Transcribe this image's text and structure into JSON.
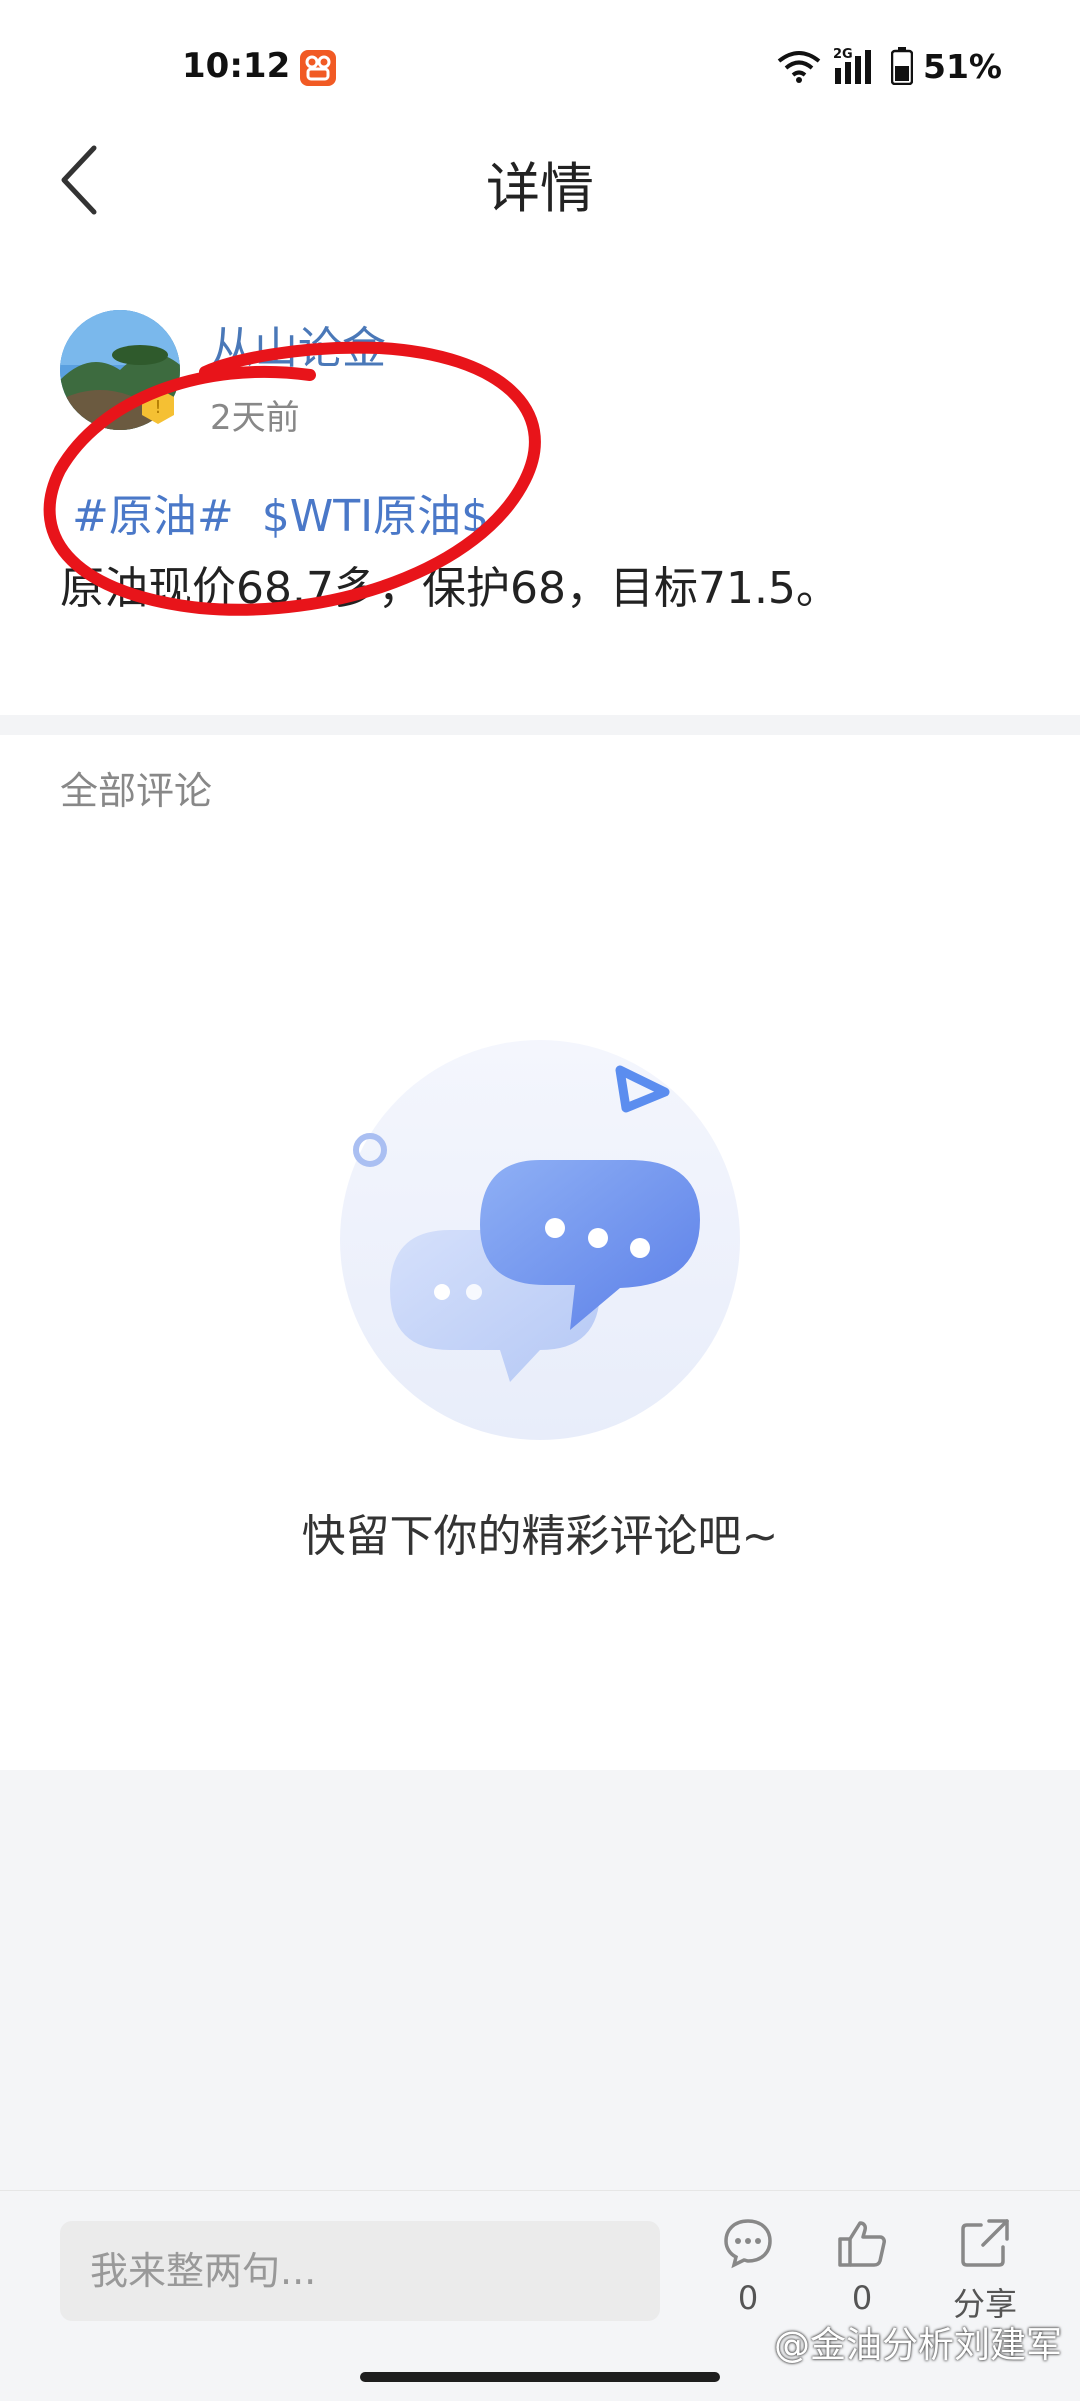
{
  "status_bar": {
    "time": "10:12",
    "network": "2G",
    "battery": "51%"
  },
  "nav": {
    "title": "详情"
  },
  "post": {
    "author": "从山论金",
    "time": "2天前",
    "tags": [
      "#原油#",
      "$WTI原油$"
    ],
    "text": "原油现价68.7多，保护68，目标71.5。"
  },
  "comments": {
    "header": "全部评论",
    "empty_text": "快留下你的精彩评论吧~"
  },
  "bottom_bar": {
    "input_placeholder": "我来整两句...",
    "comment_count": "0",
    "like_count": "0",
    "share_label": "分享"
  },
  "watermark": "@金油分析刘建军",
  "colors": {
    "link_blue": "#4a78c8",
    "annotation_red": "#e8141a",
    "illustration_blue": "#5b8def"
  }
}
